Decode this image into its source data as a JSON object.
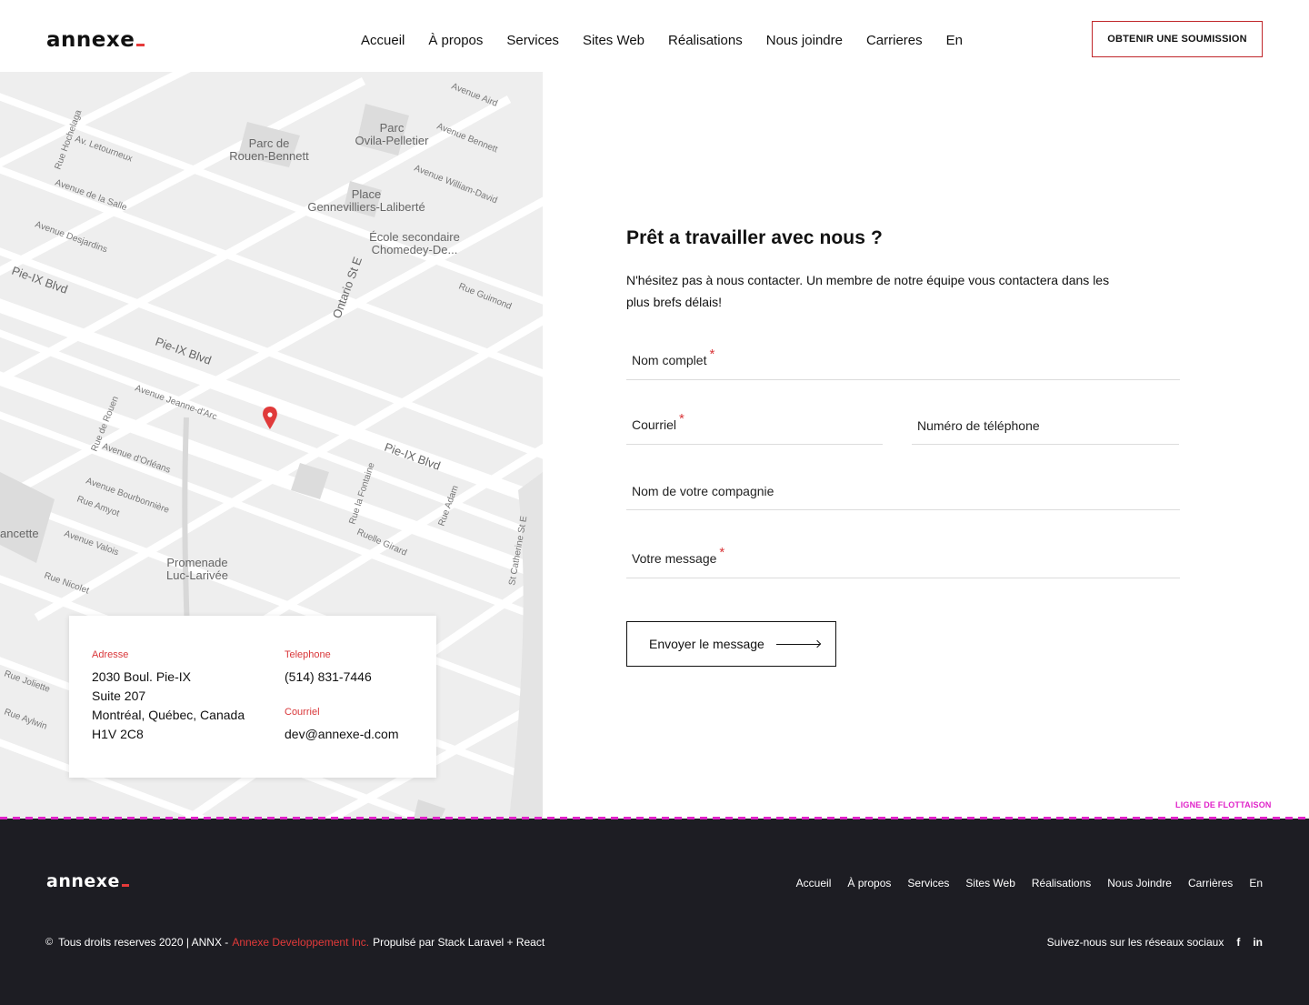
{
  "header": {
    "logo": "annexe",
    "nav": [
      "Accueil",
      "À propos",
      "Services",
      "Sites Web",
      "Réalisations",
      "Nous joindre",
      "Carrieres",
      "En"
    ],
    "cta": "OBTENIR UNE SOUMISSION"
  },
  "map": {
    "places": [
      "Parc de",
      "Rouen-Bennett",
      "Parc",
      "Ovila-Pelletier",
      "Place",
      "Gennevilliers-Laliberté",
      "École secondaire",
      "Chomedey-De...",
      "Promenade",
      "Luc-Larivée",
      "ancette"
    ],
    "streets": [
      "Rue Hochelaga",
      "Av. Letourneux",
      "Avenue de la Salle",
      "Avenue Desjardins",
      "Pie-IX Blvd",
      "Avenue Jeanne-d'Arc",
      "Rue de Rouen",
      "Avenue d'Orléans",
      "Avenue Bourbonnière",
      "Rue Amyot",
      "Avenue Valois",
      "Rue Nicolet",
      "Ontario St E",
      "Rue la Fontaine",
      "Ruelle Girard",
      "Rue Adam",
      "St Catherine St E",
      "Avenue Aird",
      "Avenue Bennett",
      "Avenue William-David",
      "Rue Guimond",
      "Rue Joliette",
      "Rue Aylwin",
      "Avenue Jeanne-d'Arc"
    ],
    "marker_color": "#e03a3a"
  },
  "contact_card": {
    "address_label": "Adresse",
    "address_lines": [
      "2030 Boul. Pie-IX",
      "Suite 207",
      "Montréal, Québec, Canada",
      "H1V 2C8"
    ],
    "phone_label": "Telephone",
    "phone": "(514) 831-7446",
    "email_label": "Courriel",
    "email": "dev@annexe-d.com"
  },
  "form": {
    "title": "Prêt a travailler avec nous ?",
    "lead": "N'hésitez pas à nous contacter. Un membre de notre équipe vous contactera dans les plus brefs délais!",
    "fields": {
      "full_name": "Nom complet",
      "email": "Courriel",
      "phone": "Numéro de téléphone",
      "company": "Nom de votre compagnie",
      "message": "Votre message"
    },
    "required_mark": "*",
    "submit": "Envoyer le message"
  },
  "fold_label": "LIGNE DE FLOTTAISON",
  "footer": {
    "logo": "annexe",
    "nav": [
      "Accueil",
      "À propos",
      "Services",
      "Sites Web",
      "Réalisations",
      "Nous Joindre",
      "Carrières",
      "En"
    ],
    "copyright_symbol": "©",
    "copyright_text": "Tous droits reserves 2020 | ANNX -",
    "company_link": "Annexe Developpement Inc.",
    "powered": "Propulsé par Stack Laravel + React",
    "social_text": "Suivez-nous sur les réseaux sociaux",
    "social_icons": [
      "facebook-icon",
      "linkedin-icon"
    ]
  },
  "colors": {
    "accent": "#e03a3a",
    "footer_bg": "#1d1d23",
    "fold": "#e022c9"
  }
}
